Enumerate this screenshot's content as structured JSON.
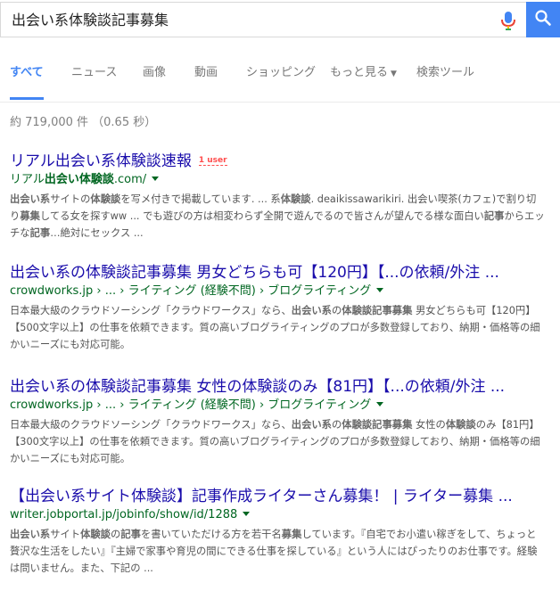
{
  "search": {
    "query": "出会い系体験談記事募集"
  },
  "tabs": [
    {
      "label": "すべて",
      "active": true
    },
    {
      "label": "ニュース"
    },
    {
      "label": "画像"
    },
    {
      "label": "動画"
    },
    {
      "label": "ショッピング"
    },
    {
      "label": "もっと見る",
      "has_caret": true
    },
    {
      "label": "検索ツール"
    }
  ],
  "stats": "約 719,000 件 （0.65 秒）",
  "results": [
    {
      "title": "リアル出会い系体験談速報",
      "badge": "1 user",
      "url": "リアル出会い体験談.com/",
      "url_bold": "出会い体験談",
      "snippet_parts": [
        {
          "t": "出会い系",
          "b": true
        },
        {
          "t": "サイトの"
        },
        {
          "t": "体験談",
          "b": true
        },
        {
          "t": "を写メ付きで掲載しています. ... 系"
        },
        {
          "t": "体験談",
          "b": true
        },
        {
          "t": ". deaikissawarikiri. 出会い喫茶(カフェ)で割り切り"
        },
        {
          "t": "募集",
          "b": true
        },
        {
          "t": "してる女を探すww ... でも遊びの方は相変わらず全開で遊んでるので皆さんが望んでる様な面白い"
        },
        {
          "t": "記事",
          "b": true
        },
        {
          "t": "からエッチな"
        },
        {
          "t": "記事",
          "b": true
        },
        {
          "t": "…絶対にセックス ..."
        }
      ]
    },
    {
      "title": "出会い系の体験談記事募集 男女どちらも可【120円】【...の依頼/外注 ...",
      "url": "crowdworks.jp › ... › ライティング (経験不問) › ブログライティング",
      "snippet_parts": [
        {
          "t": "日本最大級のクラウドソーシング「クラウドワークス」なら、"
        },
        {
          "t": "出会い系",
          "b": true
        },
        {
          "t": "の"
        },
        {
          "t": "体験談記事募集",
          "b": true
        },
        {
          "t": " 男女どちらも可【120円】【500文字以上】の仕事を依頼できます。質の高いブログライティングのプロが多数登録しており、納期・価格等の細かいニーズにも対応可能。"
        }
      ]
    },
    {
      "title": "出会い系の体験談記事募集 女性の体験談のみ【81円】【...の依頼/外注 ...",
      "url": "crowdworks.jp › ... › ライティング (経験不問) › ブログライティング",
      "snippet_parts": [
        {
          "t": "日本最大級のクラウドソーシング「クラウドワークス」なら、"
        },
        {
          "t": "出会い系",
          "b": true
        },
        {
          "t": "の"
        },
        {
          "t": "体験談記事募集",
          "b": true
        },
        {
          "t": " 女性の"
        },
        {
          "t": "体験談",
          "b": true
        },
        {
          "t": "のみ【81円】【300文字以上】の仕事を依頼できます。質の高いブログライティングのプロが多数登録しており、納期・価格等の細かいニーズにも対応可能。"
        }
      ]
    },
    {
      "title": "【出会い系サイト体験談】記事作成ライターさん募集！ | ライター募集 ...",
      "url": "writer.jobportal.jp/jobinfo/show/id/1288",
      "snippet_parts": [
        {
          "t": "出会い系",
          "b": true
        },
        {
          "t": "サイト"
        },
        {
          "t": "体験談",
          "b": true
        },
        {
          "t": "の"
        },
        {
          "t": "記事",
          "b": true
        },
        {
          "t": "を書いていただける方を若干名"
        },
        {
          "t": "募集",
          "b": true
        },
        {
          "t": "しています。『自宅でお小遣い稼ぎをして、ちょっと贅沢な生活をしたい』『主婦で家事や育児の間にできる仕事を探している』という人にはぴったりのお仕事です。経験は問いません。また、下記の ..."
        }
      ]
    }
  ],
  "colors": {
    "accent": "#4285f4",
    "link": "#1a0dab",
    "url": "#006621",
    "snippet": "#545454",
    "badge": "#ff4d4d"
  }
}
